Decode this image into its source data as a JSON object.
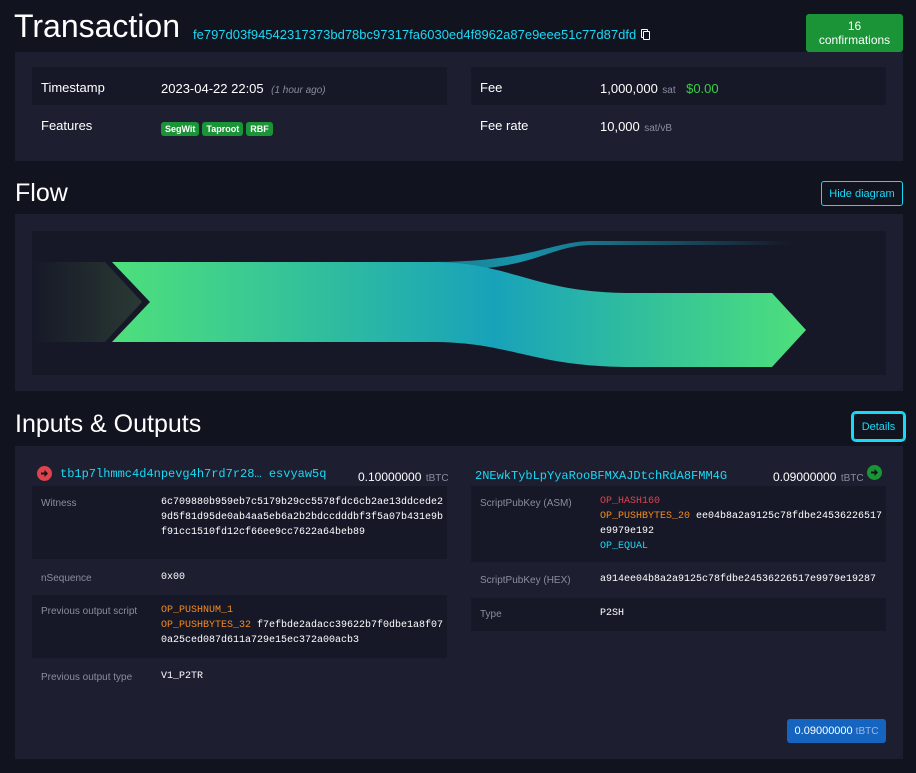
{
  "header": {
    "title": "Transaction",
    "txid": "fe797d03f94542317373bd78bc97317fa6030ed4f8962a87e9eee51c77d87dfd",
    "confirmations": "16 confirmations"
  },
  "details": {
    "timestamp_label": "Timestamp",
    "timestamp_value": "2023-04-22 22:05",
    "timestamp_ago": "(1 hour ago)",
    "features_label": "Features",
    "features": [
      "SegWit",
      "Taproot",
      "RBF"
    ],
    "fee_label": "Fee",
    "fee_value": "1,000,000",
    "fee_unit": "sat",
    "fee_fiat": "$0.00",
    "feerate_label": "Fee rate",
    "feerate_value": "10,000",
    "feerate_unit": "sat/vB"
  },
  "flow": {
    "title": "Flow",
    "hide_button": "Hide diagram",
    "colors": {
      "green": "#4ee07b",
      "teal": "#18a2ba",
      "dark": "#161827"
    }
  },
  "io": {
    "title": "Inputs & Outputs",
    "details_button": "Details",
    "input": {
      "address": "tb1p7lhmmc4d4npevg4h7rd7r28… esvyaw5q",
      "amount": "0.10000000",
      "unit": "tBTC",
      "witness_label": "Witness",
      "witness_lines": [
        "6c709880b959eb7c5179b29cc5578fdc6cb2ae13ddcede2",
        "9d5f81d95de0ab4aa5eb6a2b2bdccdddbf3f5a07b431e9b",
        "f91cc1510fd12cf66ee9cc7622a64beb89"
      ],
      "nsequence_label": "nSequence",
      "nsequence_value": "0x00",
      "prevscript_label": "Previous output script",
      "prevscript_op1": "OP_PUSHNUM_1",
      "prevscript_op2": "OP_PUSHBYTES_32",
      "prevscript_data1": "f7efbde2adacc39622b7f0dbe1a8f07",
      "prevscript_data2": "0a25ced087d611a729e15ec372a00acb3",
      "prevtype_label": "Previous output type",
      "prevtype_value": "V1_P2TR"
    },
    "output": {
      "address": "2NEwkTybLpYyaRooBFMXAJDtchRdA8FMM4G",
      "amount": "0.09000000",
      "unit": "tBTC",
      "asm_label": "ScriptPubKey (ASM)",
      "asm_op1": "OP_HASH160",
      "asm_op2": "OP_PUSHBYTES_20",
      "asm_data1": "ee04b8a2a9125c78fdbe24536226517",
      "asm_data2": "e9979e192",
      "asm_op3": "OP_EQUAL",
      "hex_label": "ScriptPubKey (HEX)",
      "hex_value": "a914ee04b8a2a9125c78fdbe24536226517e9979e19287",
      "type_label": "Type",
      "type_value": "P2SH"
    },
    "total_amount": "0.09000000",
    "total_unit": "tBTC"
  }
}
